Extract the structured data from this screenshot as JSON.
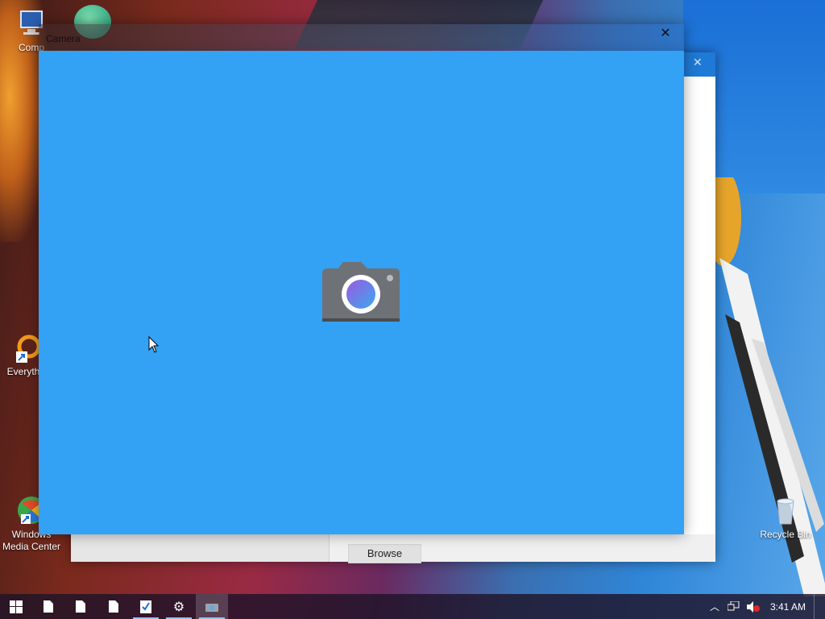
{
  "desktop": {
    "icons": [
      {
        "label": "Comp",
        "icon": "computer-icon"
      },
      {
        "label": "Everyth",
        "icon": "everything-search-icon"
      },
      {
        "label": "Windows Media Center",
        "icon": "media-center-icon"
      },
      {
        "label": "Recycle Bin",
        "icon": "recycle-bin-icon"
      }
    ]
  },
  "camera_window": {
    "title": "Camera",
    "close_glyph": "✕",
    "background_color": "#33a1f4",
    "center_icon": "camera-icon"
  },
  "background_dialog": {
    "close_glyph": "✕",
    "browse_label": "Browse"
  },
  "taskbar": {
    "start_icon": "windows-logo-icon",
    "items": [
      {
        "icon": "document-icon"
      },
      {
        "icon": "document-icon"
      },
      {
        "icon": "document-icon"
      },
      {
        "icon": "checklist-icon"
      },
      {
        "icon": "gear-icon"
      },
      {
        "icon": "camera-icon"
      }
    ],
    "tray": {
      "chevron_icon": "chevron-up-icon",
      "network_icon": "network-icon",
      "volume_icon": "volume-muted-icon",
      "clock": "3:41 AM"
    }
  },
  "colors": {
    "accent": "#1e7ad6",
    "camera_bg": "#33a1f4"
  }
}
